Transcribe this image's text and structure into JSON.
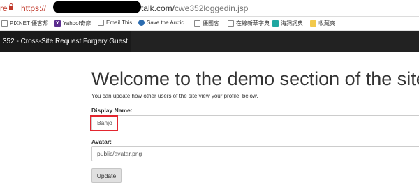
{
  "browser": {
    "scheme_fragment": "re",
    "https": "https://",
    "host_suffix": "talk.com/",
    "path": "cwe352loggedin.jsp",
    "bookmarks": [
      {
        "icon": "doc-icon",
        "label": "PIXNET 優客邦"
      },
      {
        "icon": "yahoo-icon",
        "label": "Yahoo!奇摩"
      },
      {
        "icon": "doc-icon",
        "label": "Email This"
      },
      {
        "icon": "globe-icon",
        "label": "Save the Arctic"
      },
      {
        "icon": "doc-icon",
        "label": "優團客"
      },
      {
        "icon": "doc-icon",
        "label": "在線新華字典"
      },
      {
        "icon": "dict-icon",
        "label": "海詞詞典"
      },
      {
        "icon": "folder-icon",
        "label": "收藏夾"
      }
    ]
  },
  "app": {
    "title": "352 - Cross-Site Request Forgery Guest"
  },
  "main": {
    "heading": "Welcome to the demo section of the site.",
    "intro": "You can update how other users of the site view your profile, below.",
    "display_name_label": "Display Name:",
    "display_name_value": "Banjo",
    "avatar_label": "Avatar:",
    "avatar_value": "public/avatar.png",
    "update_button": "Update"
  },
  "colors": {
    "appbar": "#222222",
    "highlight": "#e3262f"
  }
}
